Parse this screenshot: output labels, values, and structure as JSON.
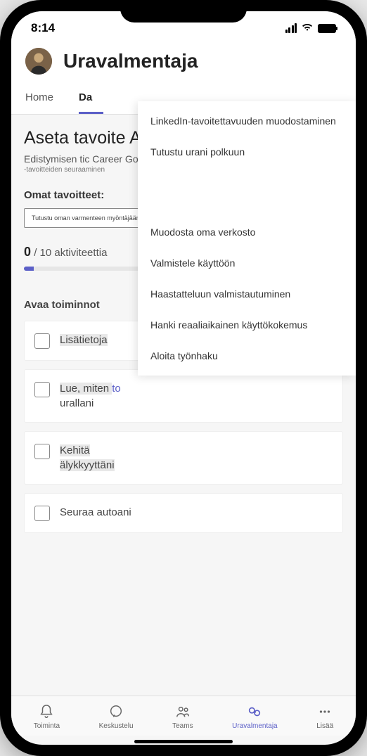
{
  "status": {
    "time": "8:14"
  },
  "header": {
    "title": "Uravalmentaja"
  },
  "tabs": {
    "items": [
      {
        "label": "Home"
      },
      {
        "label": "Da"
      }
    ],
    "activeIndex": 1
  },
  "main": {
    "heading": "Aseta tavoite Aloita urani matka",
    "subheading": "Edistymisen tic Career Goals",
    "subheading_small": "-tavoitteiden seuraaminen",
    "goals_label": "Omat tavoitteet:",
    "goal_chip": "Tutustu oman varmenteen myöntäjään",
    "progress": {
      "count": "0",
      "total": "/ 10 aktiviteettia"
    },
    "actions_title": "Avaa toiminnot",
    "actions": [
      {
        "text": "Lisätietoja"
      },
      {
        "text_a": "Lue, miten ",
        "text_link": "to",
        "text_b": "urallani"
      },
      {
        "text_a": "Kehitä",
        "text_b": "älykkyyttäni"
      },
      {
        "text": "Seuraa autoani"
      }
    ]
  },
  "dropdown": {
    "items": [
      "LinkedIn-tavoitettavuuden muodostaminen",
      "Tutustu urani polkuun",
      "Muodosta oma verkosto",
      "Valmistele käyttöön",
      "Haastatteluun valmistautuminen",
      "Hanki reaaliaikainen käyttökokemus",
      "Aloita työnhaku"
    ]
  },
  "bottomNav": {
    "items": [
      {
        "label": "Toiminta",
        "icon": "bell"
      },
      {
        "label": "Keskustelu",
        "icon": "chat"
      },
      {
        "label": "Teams",
        "icon": "teams"
      },
      {
        "label": "Uravalmentaja",
        "icon": "coach"
      },
      {
        "label": "Lisää",
        "icon": "more"
      }
    ],
    "activeIndex": 3
  }
}
